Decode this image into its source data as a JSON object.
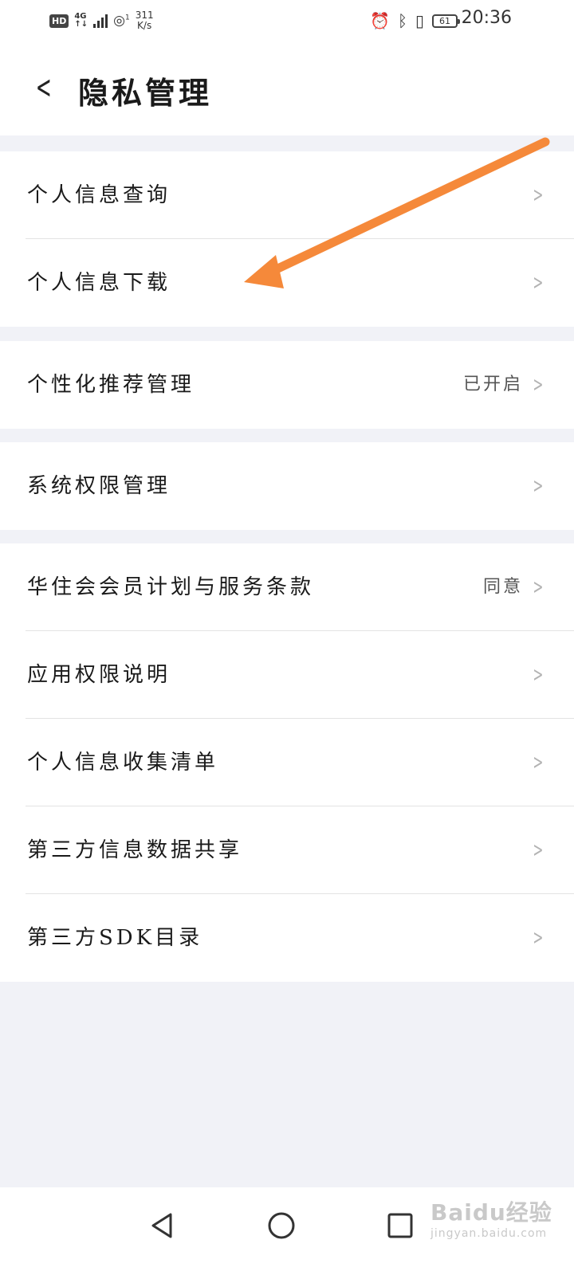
{
  "status_bar": {
    "network_badge": "HD",
    "network_type": "4G",
    "network_arrows": "↑↓",
    "signal_sup": "1",
    "speed_value": "311",
    "speed_unit": "K/s",
    "time": "20:36",
    "battery": "61",
    "icons": [
      "alarm-icon",
      "bluetooth-icon",
      "vibrate-icon"
    ]
  },
  "header": {
    "title": "隐私管理",
    "back_glyph": "<"
  },
  "groups": [
    {
      "items": [
        {
          "label": "个人信息查询",
          "value": ""
        },
        {
          "label": "个人信息下载",
          "value": ""
        }
      ]
    },
    {
      "items": [
        {
          "label": "个性化推荐管理",
          "value": "已开启"
        }
      ]
    },
    {
      "items": [
        {
          "label": "系统权限管理",
          "value": ""
        }
      ]
    },
    {
      "items": [
        {
          "label": "华住会会员计划与服务条款",
          "value": "同意"
        },
        {
          "label": "应用权限说明",
          "value": ""
        },
        {
          "label": "个人信息收集清单",
          "value": ""
        },
        {
          "label": "第三方信息数据共享",
          "value": ""
        },
        {
          "label": "第三方SDK目录",
          "value": ""
        }
      ]
    }
  ],
  "chevron": ">",
  "nav_bar": [
    "back-nav-icon",
    "home-nav-icon",
    "recents-nav-icon"
  ],
  "watermark": {
    "brand": "Baidu经验",
    "site": "jingyan.baidu.com"
  },
  "annotation": {
    "color": "#f5893a"
  }
}
